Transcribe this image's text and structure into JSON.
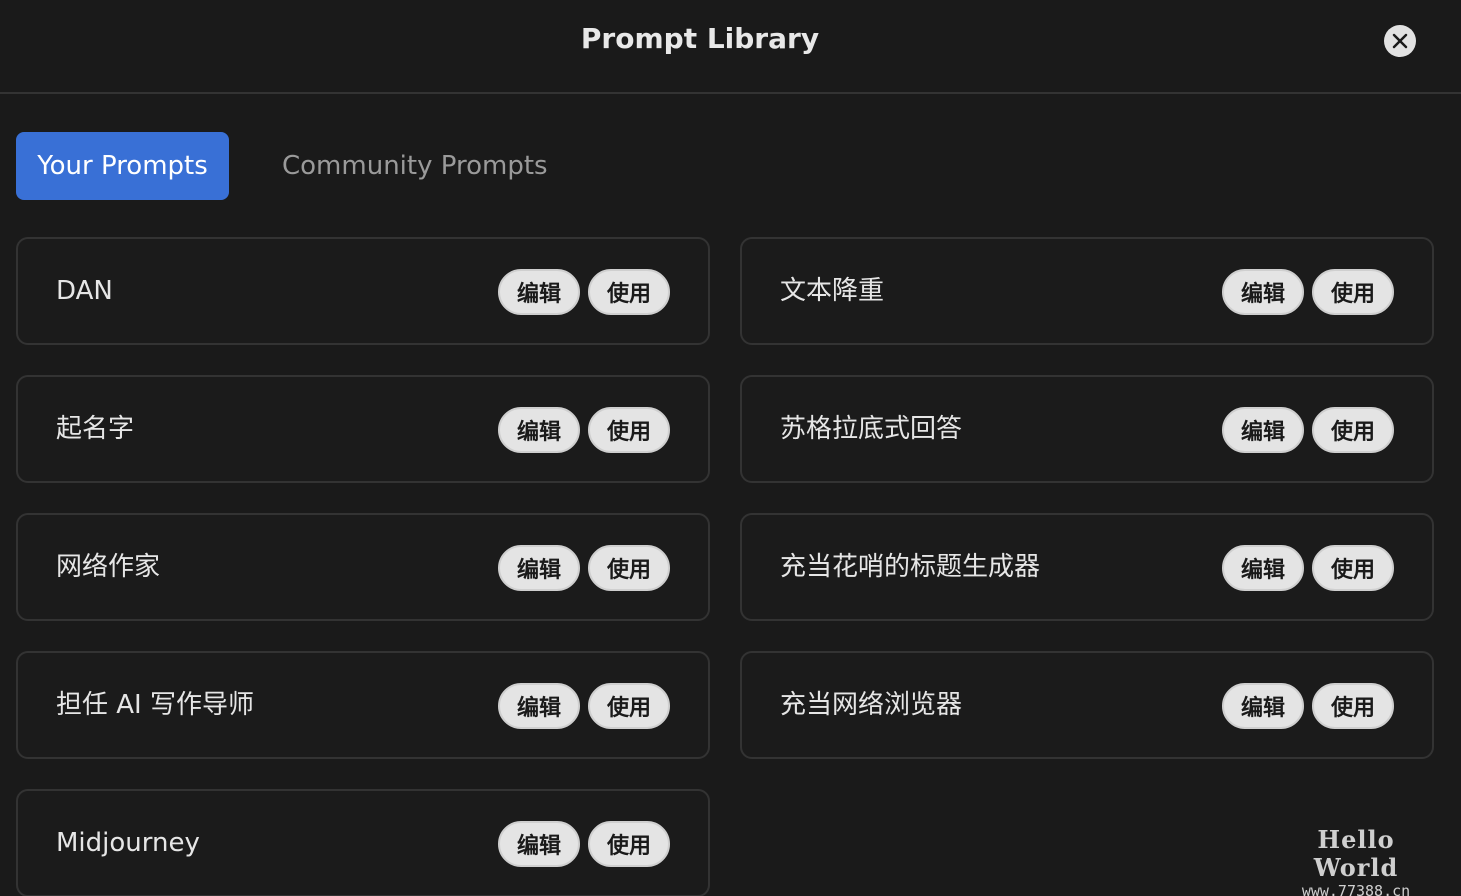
{
  "header": {
    "title": "Prompt Library",
    "close_icon": "close-icon"
  },
  "tabs": [
    {
      "label": "Your Prompts",
      "active": true
    },
    {
      "label": "Community Prompts",
      "active": false
    }
  ],
  "prompts": [
    {
      "title": "DAN",
      "edit_label": "编辑",
      "use_label": "使用"
    },
    {
      "title": "文本降重",
      "edit_label": "编辑",
      "use_label": "使用"
    },
    {
      "title": "起名字",
      "edit_label": "编辑",
      "use_label": "使用"
    },
    {
      "title": "苏格拉底式回答",
      "edit_label": "编辑",
      "use_label": "使用"
    },
    {
      "title": "网络作家",
      "edit_label": "编辑",
      "use_label": "使用"
    },
    {
      "title": "充当花哨的标题生成器",
      "edit_label": "编辑",
      "use_label": "使用"
    },
    {
      "title": "担任 AI 写作导师",
      "edit_label": "编辑",
      "use_label": "使用"
    },
    {
      "title": "充当网络浏览器",
      "edit_label": "编辑",
      "use_label": "使用"
    },
    {
      "title": "Midjourney",
      "edit_label": "编辑",
      "use_label": "使用"
    }
  ],
  "watermark": {
    "line1": "Hello World",
    "line2": "www.77388.cn"
  },
  "colors": {
    "accent": "#3970d6",
    "background": "#1a1a1a",
    "border": "#333333",
    "pill": "#e4e4e4"
  }
}
